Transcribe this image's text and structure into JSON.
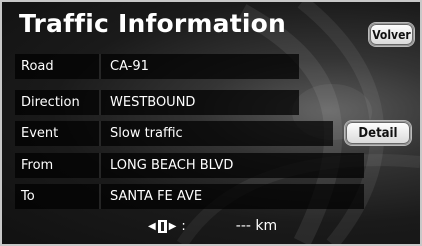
{
  "header": {
    "title": "Traffic Information"
  },
  "buttons": {
    "back_label": "Volver",
    "detail_label": "Detail"
  },
  "rows": [
    {
      "label": "Road",
      "value": "CA-91"
    },
    {
      "label": "Direction",
      "value": "WESTBOUND"
    },
    {
      "label": "Event",
      "value": "Slow traffic"
    },
    {
      "label": "From",
      "value": "LONG BEACH BLVD"
    },
    {
      "label": "To",
      "value": "SANTA FE AVE"
    }
  ],
  "footer": {
    "left_arrow": "◀",
    "right_arrow": "▶",
    "colon": ":",
    "distance": "--- km"
  },
  "colors": {
    "background": "#1a1a1a",
    "text": "#ffffff",
    "button": "#e6e6e6"
  }
}
